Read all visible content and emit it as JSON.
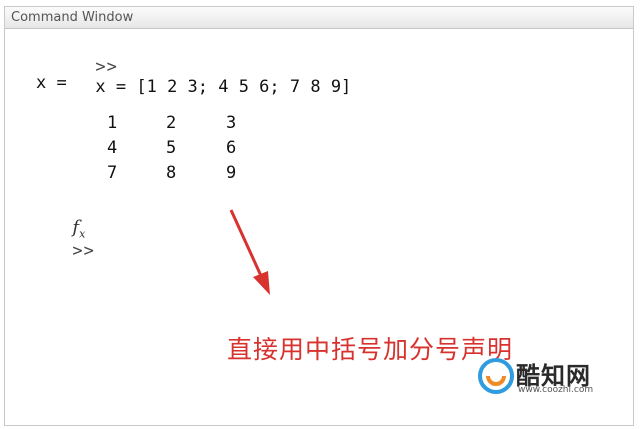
{
  "window": {
    "title": "Command Window"
  },
  "console": {
    "prompt": ">>",
    "command": "x = [1 2 3; 4 5 6; 7 8 9]",
    "output_label": "x =",
    "matrix": [
      [
        "1",
        "2",
        "3"
      ],
      [
        "4",
        "5",
        "6"
      ],
      [
        "7",
        "8",
        "9"
      ]
    ],
    "fx_symbol": "f",
    "fx_sub": "x",
    "current_prompt": ">>"
  },
  "annotation": {
    "text": "直接用中括号加分号声明",
    "color": "#d8322e"
  },
  "watermark": {
    "brand": "酷知网",
    "url": "www.coozhi.com"
  }
}
